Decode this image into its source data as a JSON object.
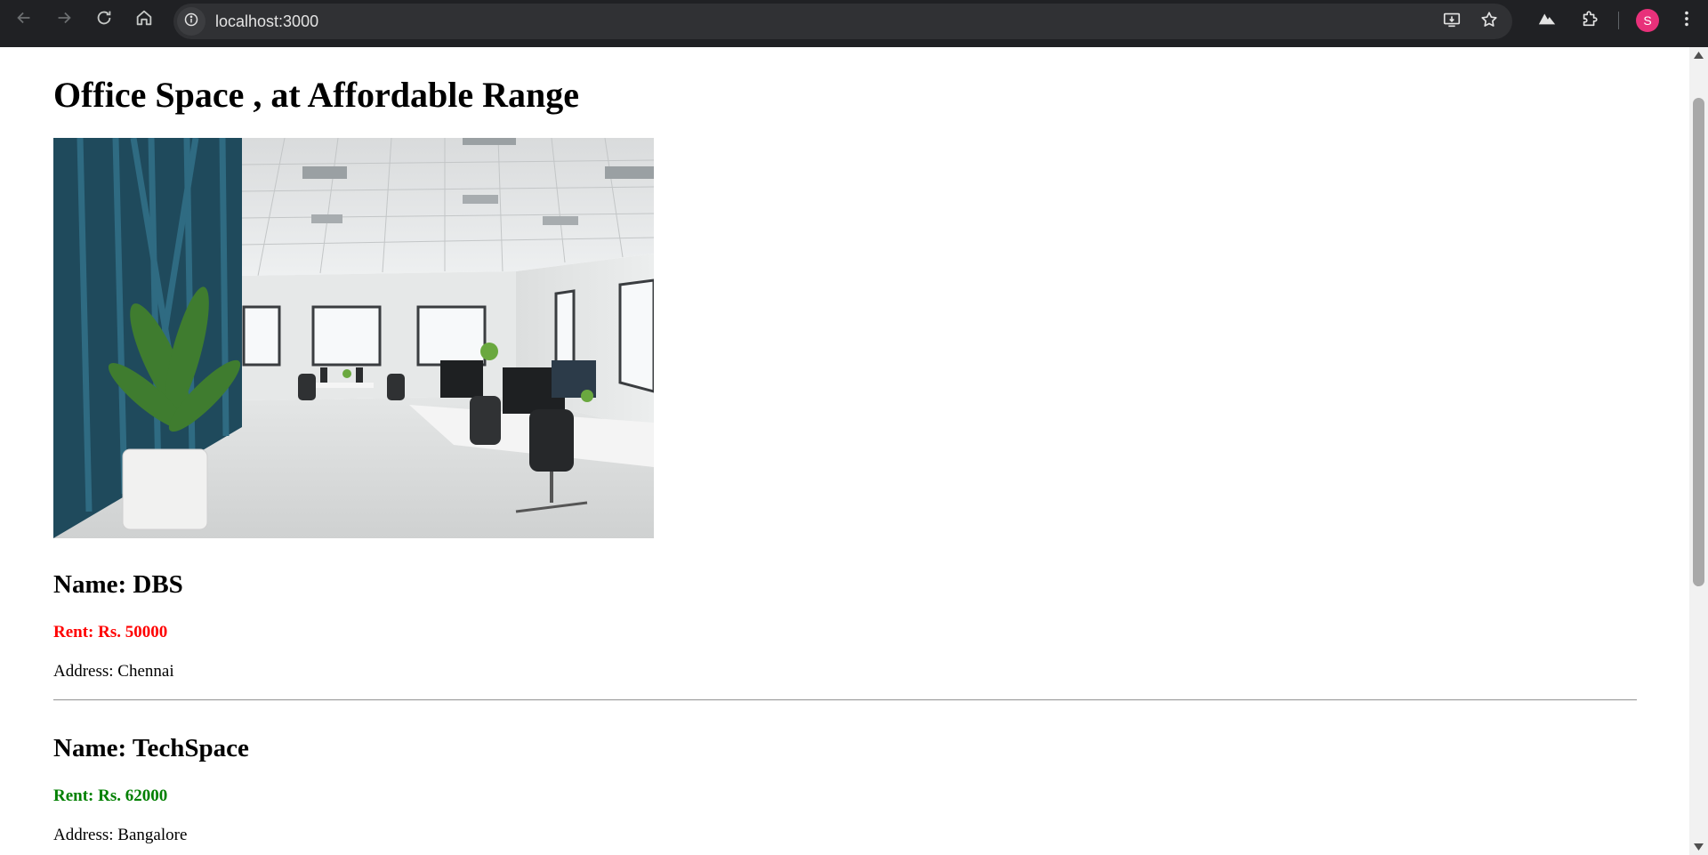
{
  "browser": {
    "url": "localhost:3000",
    "profile_initial": "S",
    "profile_color": "#e8317a"
  },
  "page": {
    "title": "Office Space , at Affordable Range",
    "image_subject": "open-plan office interior with blue wall, plant, white desks and black chairs"
  },
  "listings": [
    {
      "name": "Name: DBS",
      "rent": "Rent: Rs. 50000",
      "rent_color": "#ff0000",
      "address": "Address: Chennai"
    },
    {
      "name": "Name: TechSpace",
      "rent": "Rent: Rs. 62000",
      "rent_color": "#008000",
      "address": "Address: Bangalore"
    }
  ]
}
